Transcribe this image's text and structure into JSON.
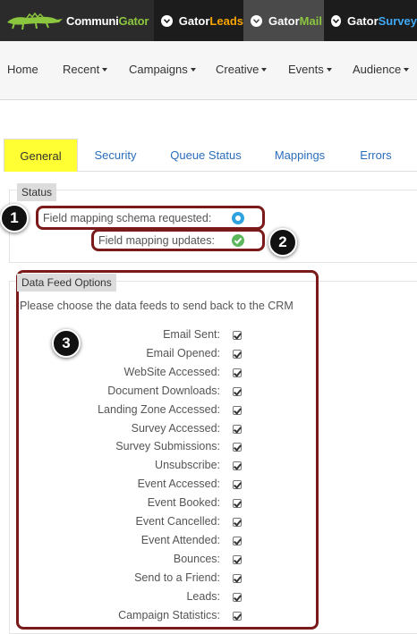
{
  "brand": {
    "part1": "Communi",
    "part2": "Gator"
  },
  "products": [
    {
      "part1": "Gator",
      "part2": "Leads",
      "accent": "#f7a500"
    },
    {
      "part1": "Gator",
      "part2": "Mail",
      "accent": "#8cc63f"
    },
    {
      "part1": "Gator",
      "part2": "Survey",
      "accent": "#3fa9f5"
    }
  ],
  "nav": [
    "Home",
    "Recent",
    "Campaigns",
    "Creative",
    "Events",
    "Audience"
  ],
  "tabs": [
    "General",
    "Security",
    "Queue Status",
    "Mappings",
    "Errors"
  ],
  "status": {
    "legend": "Status",
    "rows": [
      {
        "label": "Field mapping schema requested:",
        "icon": "radio-icon"
      },
      {
        "label": "Field mapping updates:",
        "icon": "check-icon"
      }
    ]
  },
  "data_feed": {
    "legend": "Data Feed Options",
    "intro": "Please choose the data feeds to send back to the CRM",
    "items": [
      {
        "label": "Email Sent:",
        "checked": true
      },
      {
        "label": "Email Opened:",
        "checked": true
      },
      {
        "label": "WebSite Accessed:",
        "checked": true
      },
      {
        "label": "Document Downloads:",
        "checked": true
      },
      {
        "label": "Landing Zone Accessed:",
        "checked": true
      },
      {
        "label": "Survey Accessed:",
        "checked": true
      },
      {
        "label": "Survey Submissions:",
        "checked": true
      },
      {
        "label": "Unsubscribe:",
        "checked": true
      },
      {
        "label": "Event Accessed:",
        "checked": true
      },
      {
        "label": "Event Booked:",
        "checked": true
      },
      {
        "label": "Event Cancelled:",
        "checked": true
      },
      {
        "label": "Event Attended:",
        "checked": true
      },
      {
        "label": "Bounces:",
        "checked": true
      },
      {
        "label": "Send to a Friend:",
        "checked": true
      },
      {
        "label": "Leads:",
        "checked": true
      },
      {
        "label": "Campaign Statistics:",
        "checked": true
      }
    ]
  },
  "callouts": [
    "1",
    "2",
    "3"
  ],
  "colors": {
    "active_tab": "#ffff33",
    "link": "#2a6ebb",
    "callout_border": "#7a1a1a"
  }
}
